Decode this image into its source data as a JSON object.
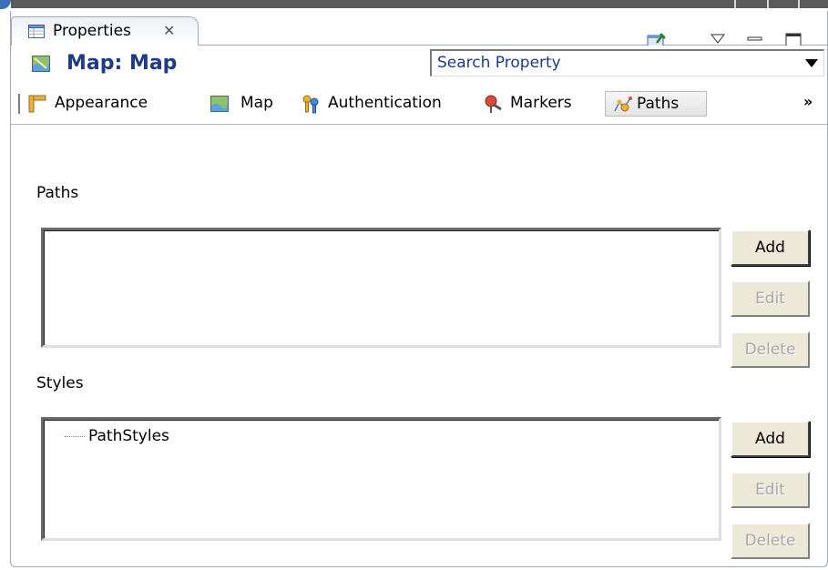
{
  "view": {
    "tab_label": "Properties",
    "tab_close": "✕"
  },
  "header": {
    "title": "Map: Map",
    "search_value": "Search Property"
  },
  "section_tabs": [
    {
      "label": "Appearance",
      "icon": "ruler-icon"
    },
    {
      "label": "Map",
      "icon": "map-icon"
    },
    {
      "label": "Authentication",
      "icon": "keys-icon"
    },
    {
      "label": "Markers",
      "icon": "marker-pin-icon"
    },
    {
      "label": "Paths",
      "icon": "paths-icon",
      "active": true
    }
  ],
  "overflow": "»",
  "paths_section": {
    "label": "Paths",
    "add": "Add",
    "edit": "Edit",
    "delete": "Delete"
  },
  "styles_section": {
    "label": "Styles",
    "tree_item": "PathStyles",
    "add": "Add",
    "edit": "Edit",
    "delete": "Delete"
  },
  "colors": {
    "title_blue": "#1f3b87",
    "button_face": "#ece9d8",
    "disabled_text": "#a7a6aa"
  }
}
